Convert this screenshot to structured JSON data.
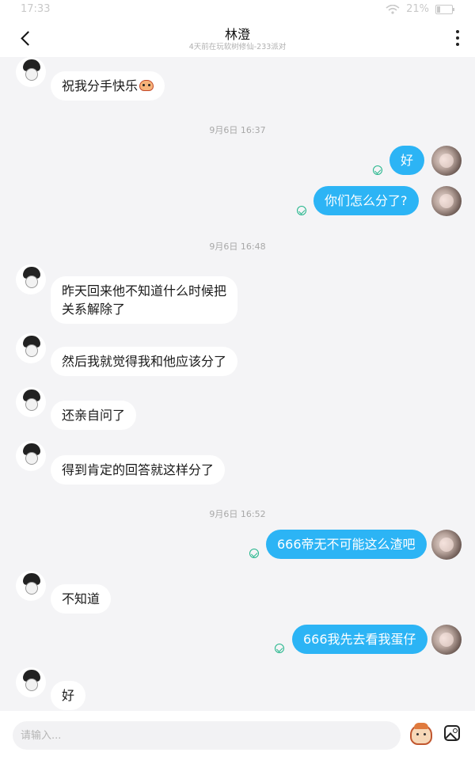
{
  "status_bar": {
    "time": "17:33",
    "battery": "21%"
  },
  "header": {
    "title": "林澄",
    "subtitle": "4天前在玩软树修仙-233派对"
  },
  "messages": [
    {
      "type": "in",
      "text": "祝我分手快乐",
      "emoji": "face-emoji"
    },
    {
      "type": "time",
      "text": "9月6日 16:37"
    },
    {
      "type": "out",
      "text": "好",
      "status": "read"
    },
    {
      "type": "out",
      "text": "你们怎么分了?",
      "status": "read"
    },
    {
      "type": "time",
      "text": "9月6日 16:48"
    },
    {
      "type": "in",
      "text": "昨天回来他不知道什么时候把关系解除了"
    },
    {
      "type": "in",
      "text": "然后我就觉得我和他应该分了"
    },
    {
      "type": "in",
      "text": "还亲自问了"
    },
    {
      "type": "in",
      "text": "得到肯定的回答就这样分了"
    },
    {
      "type": "time",
      "text": "9月6日 16:52"
    },
    {
      "type": "out",
      "text": "666帝无不可能这么渣吧",
      "status": "read"
    },
    {
      "type": "in",
      "text": "不知道"
    },
    {
      "type": "out",
      "text": "666我先去看我蛋仔",
      "status": "read"
    },
    {
      "type": "in",
      "text": "好"
    }
  ],
  "input_bar": {
    "placeholder": "请输入...",
    "emoji_icon": "emoji-face-icon",
    "image_icon": "image-icon"
  },
  "colors": {
    "outgoing_bubble": "#2cb4f5",
    "incoming_bubble": "#ffffff",
    "background": "#f4f4f6",
    "read_check": "#21b58a"
  }
}
